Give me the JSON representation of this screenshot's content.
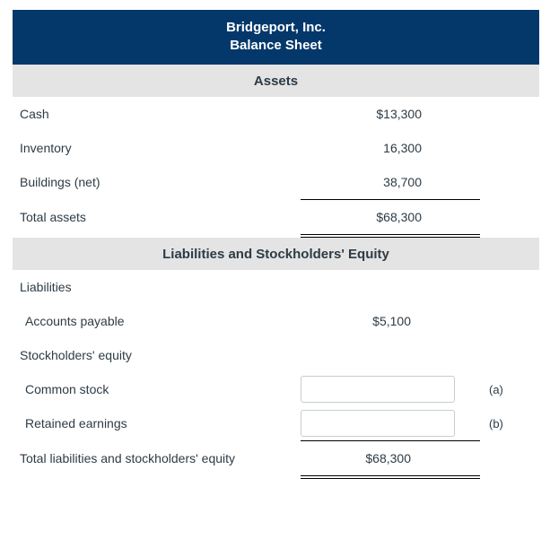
{
  "statement": {
    "company": "Bridgeport, Inc.",
    "statement_title": "Balance Sheet",
    "accent_color": "#04386b",
    "band_color": "#e4e4e4",
    "text_color": "#2d3b45",
    "sections": [
      {
        "heading": "Assets",
        "rows": [
          {
            "label": "Cash",
            "value": "$13,300"
          },
          {
            "label": "Inventory",
            "value": "16,300"
          },
          {
            "label": "Buildings (net)",
            "value": "38,700"
          },
          {
            "label": "Total assets",
            "value": "$68,300"
          }
        ]
      },
      {
        "heading": "Liabilities and Stockholders' Equity",
        "rows": [
          {
            "label": "Liabilities",
            "value": ""
          },
          {
            "label": "Accounts payable",
            "value": "$5,100"
          },
          {
            "label": "Stockholders' equity",
            "value": ""
          },
          {
            "label": "Common stock",
            "value": "",
            "note": "(a)",
            "input": true
          },
          {
            "label": "Retained earnings",
            "value": "",
            "note": "(b)",
            "input": true
          },
          {
            "label": "Total liabilities and stockholders' equity",
            "value": "$68,300"
          }
        ]
      }
    ]
  },
  "inputs": {
    "common_stock": {
      "value": "",
      "placeholder": ""
    },
    "retained_earnings": {
      "value": "",
      "placeholder": ""
    }
  }
}
